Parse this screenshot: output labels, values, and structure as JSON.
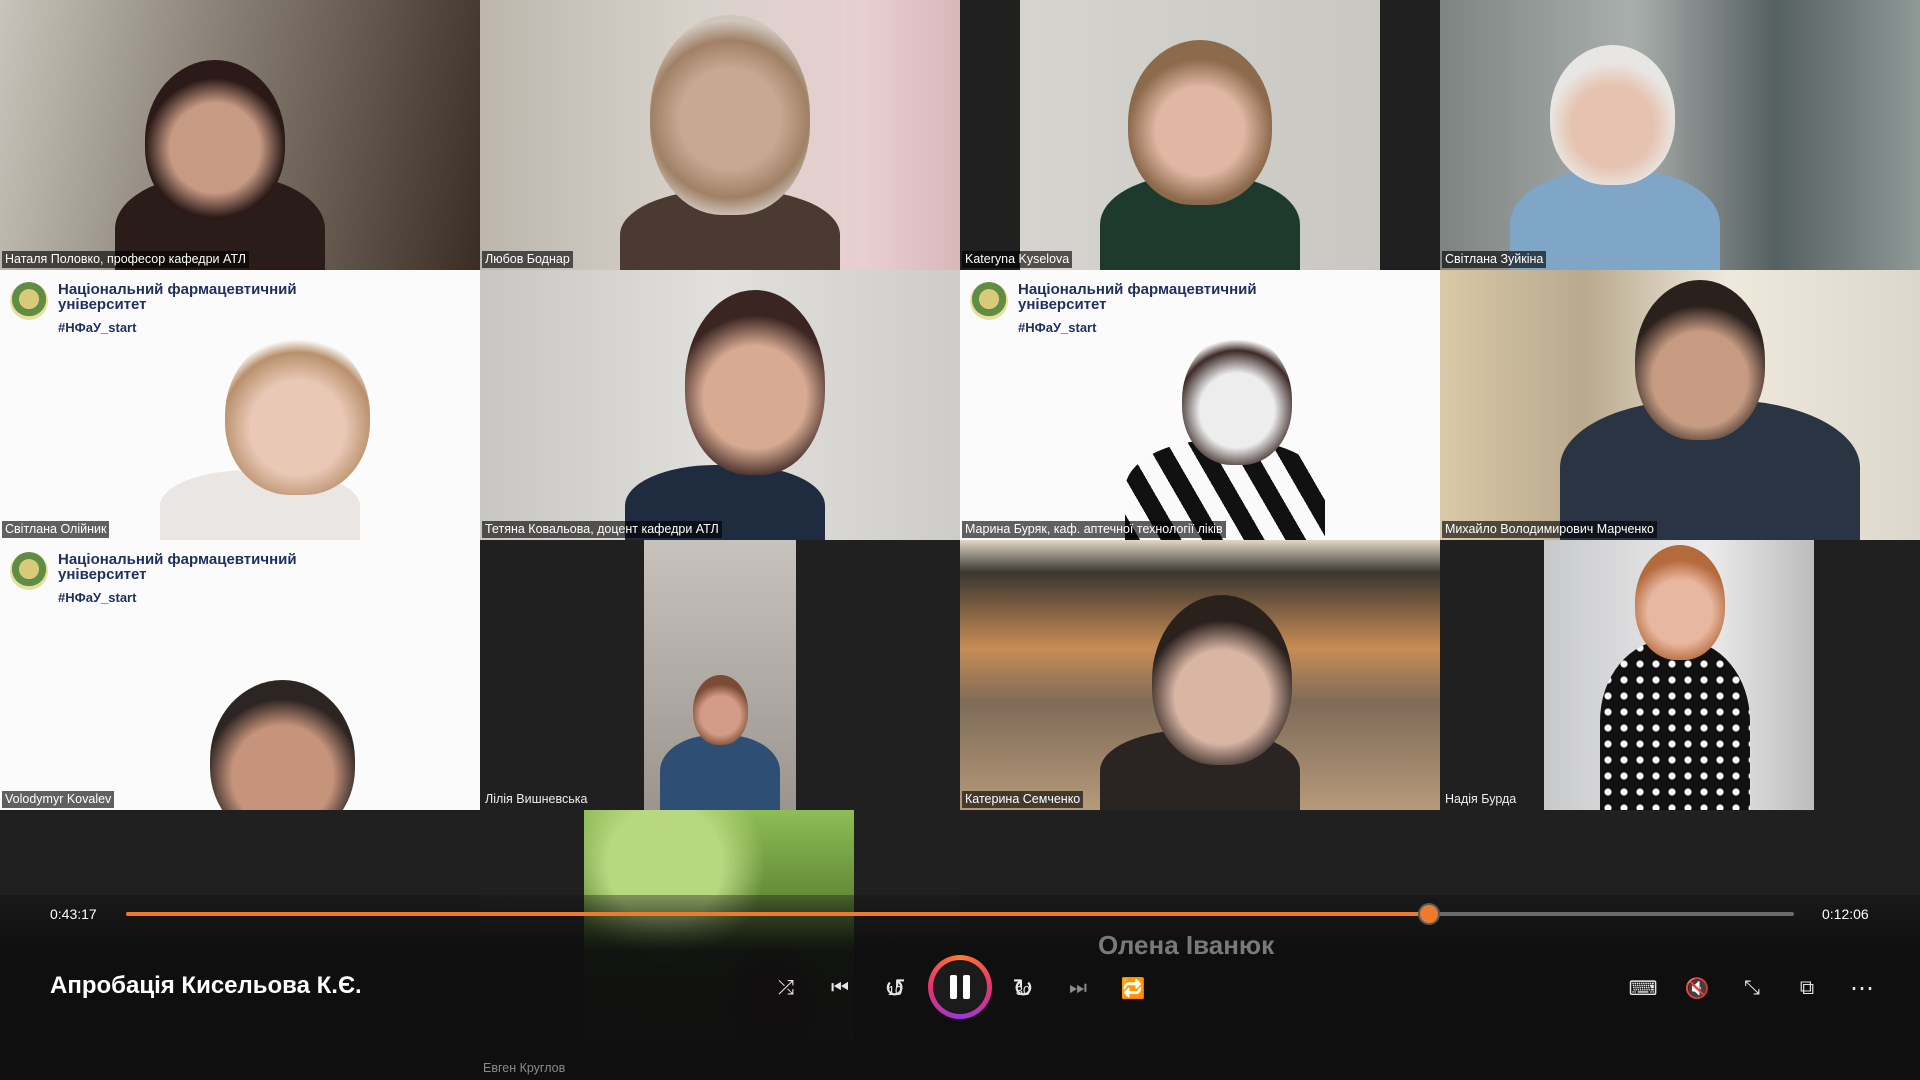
{
  "participants": [
    {
      "name": "Наталя Половко, професор кафедри АТЛ"
    },
    {
      "name": "Любов Боднар"
    },
    {
      "name": "Kateryna Kyselova"
    },
    {
      "name": "Світлана Зуйкіна"
    },
    {
      "name": "Світлана Олійник"
    },
    {
      "name": "Тетяна Ковальова, доцент кафедри АТЛ"
    },
    {
      "name": "Марина Буряк, каф. аптечної технології ліків"
    },
    {
      "name": "Михайло Володимирович Марченко"
    },
    {
      "name": "Volodymyr Kovalev"
    },
    {
      "name": "Лілія Вишневська"
    },
    {
      "name": "Катерина Семченко"
    },
    {
      "name": "Надія Бурда"
    },
    {
      "name": "Евген Круглов"
    }
  ],
  "university_overlay": {
    "line1": "Національний фармацевтичний",
    "line2": "університет",
    "hashtag": "#НФаУ_start"
  },
  "active_speaker": "Олена Іванюк",
  "player": {
    "title": "Апробація Кисельова К.Є.",
    "elapsed": "0:43:17",
    "remaining": "0:12:06",
    "progress": 0.781,
    "accent_color": "#ee7a2e",
    "controls": {
      "shuffle": "⤮",
      "previous": "⏮",
      "rewind_10": "10",
      "forward_30": "30",
      "next": "⏭",
      "repeat": "🔁",
      "captions": "⌨",
      "mute": "🔇",
      "compact": "⤡",
      "miniplayer": "⧉",
      "more": "⋯"
    }
  }
}
